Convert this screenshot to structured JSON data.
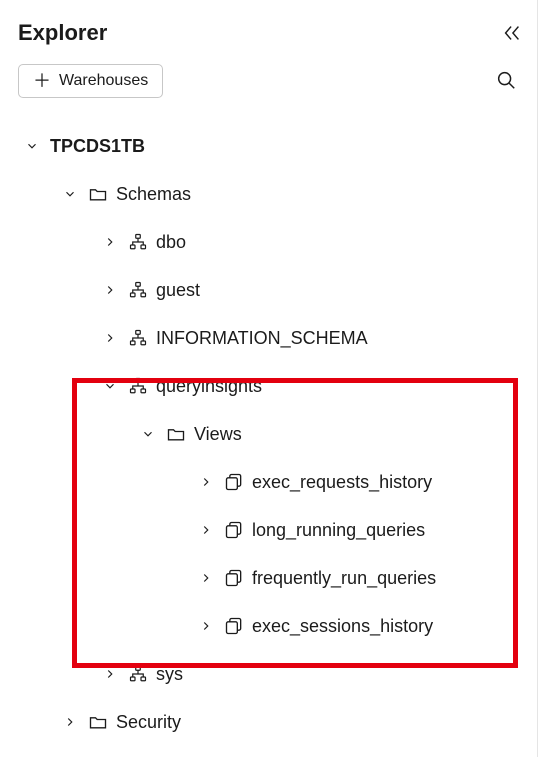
{
  "header": {
    "title": "Explorer"
  },
  "toolbar": {
    "add_warehouse_label": "Warehouses"
  },
  "tree": {
    "root_label": "TPCDS1TB",
    "schemas_label": "Schemas",
    "schemas": {
      "dbo": "dbo",
      "guest": "guest",
      "info_schema": "INFORMATION_SCHEMA",
      "queryinsights": "queryinsights",
      "sys": "sys"
    },
    "views_label": "Views",
    "views": {
      "exec_requests_history": "exec_requests_history",
      "long_running_queries": "long_running_queries",
      "frequently_run_queries": "frequently_run_queries",
      "exec_sessions_history": "exec_sessions_history"
    },
    "security_label": "Security"
  }
}
